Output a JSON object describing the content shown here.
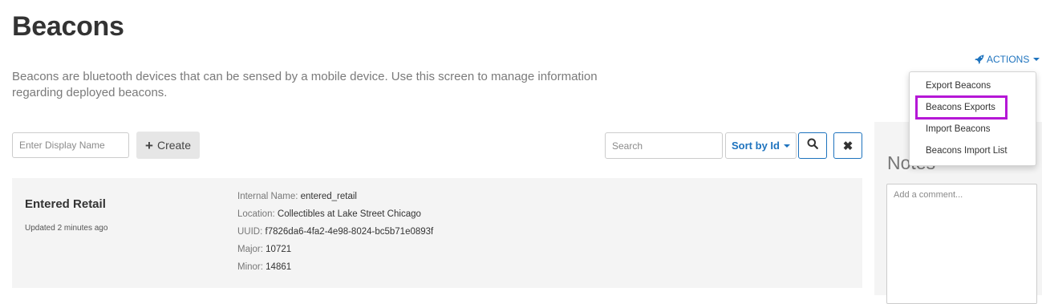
{
  "page": {
    "title": "Beacons",
    "description": "Beacons are bluetooth devices that can be sensed by a mobile device. Use this screen to manage information regarding deployed beacons."
  },
  "actions": {
    "label": "ACTIONS",
    "icon": "rocket-icon",
    "menu": [
      "Export Beacons",
      "Beacons Exports",
      "Import Beacons",
      "Beacons Import List"
    ],
    "highlighted_item": "Beacons Exports",
    "highlight_color": "#b517d6"
  },
  "toolbar": {
    "display_name_placeholder": "Enter Display Name",
    "create_label": "Create",
    "search_placeholder": "Search",
    "sort_label": "Sort by Id"
  },
  "beacon": {
    "name": "Entered Retail",
    "updated": "Updated 2 minutes ago",
    "details": [
      {
        "label": "Internal Name:",
        "value": "entered_retail"
      },
      {
        "label": "Location:",
        "value": "Collectibles at Lake Street Chicago"
      },
      {
        "label": "UUID:",
        "value": "f7826da6-4fa2-4e98-8024-bc5b71e0893f"
      },
      {
        "label": "Major:",
        "value": "10721"
      },
      {
        "label": "Minor:",
        "value": "14861"
      }
    ]
  },
  "notes": {
    "title": "Notes",
    "placeholder": "Add a comment..."
  },
  "colors": {
    "accent": "#1e73be",
    "card_background": "#f4f4f4"
  }
}
